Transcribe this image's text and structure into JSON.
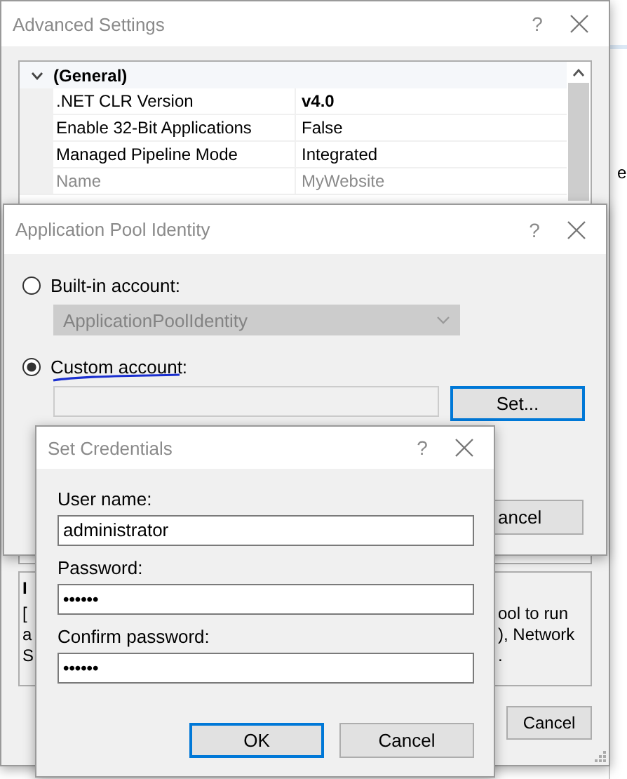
{
  "background_window": {
    "text_fragment": "e"
  },
  "advanced_settings": {
    "title": "Advanced Settings",
    "help": "?",
    "property_grid": {
      "category": {
        "label": "(General)",
        "expanded": true
      },
      "rows": [
        {
          "name": ".NET CLR Version",
          "value": "v4.0",
          "modified": true,
          "disabled": false
        },
        {
          "name": "Enable 32-Bit Applications",
          "value": "False",
          "modified": false,
          "disabled": false
        },
        {
          "name": "Managed Pipeline Mode",
          "value": "Integrated",
          "modified": false,
          "disabled": false
        },
        {
          "name": "Name",
          "value": "MyWebsite",
          "modified": false,
          "disabled": true
        }
      ]
    },
    "description": {
      "left_fragments": [
        "I",
        "[",
        "a",
        "S"
      ],
      "right_fragments": [
        "ool to run",
        "), Network",
        "."
      ]
    },
    "buttons": [
      {
        "label": "Cancel"
      }
    ]
  },
  "app_pool_identity": {
    "title": "Application Pool Identity",
    "help": "?",
    "options": [
      {
        "kind": "dropdown",
        "label": "Built-in account:",
        "selected": false,
        "value": "ApplicationPoolIdentity",
        "disabled": true
      },
      {
        "kind": "field",
        "label": "Custom account:",
        "selected": true,
        "button": "Set...",
        "button_focused": true
      }
    ],
    "cancel_fragment": "ancel"
  },
  "set_credentials": {
    "title": "Set Credentials",
    "help": "?",
    "fields": [
      {
        "label": "User name:",
        "value": "administrator",
        "kind": "text"
      },
      {
        "label": "Password:",
        "value": "••••••",
        "kind": "password"
      },
      {
        "label": "Confirm password:",
        "value": "••••••",
        "kind": "password"
      }
    ],
    "buttons": [
      {
        "label": "OK",
        "focused": true
      },
      {
        "label": "Cancel",
        "focused": false
      }
    ]
  }
}
